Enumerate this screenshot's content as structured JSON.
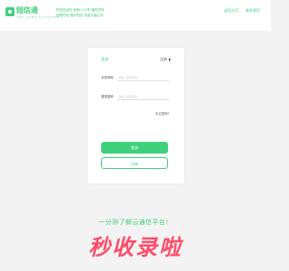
{
  "header": {
    "logo_text": "短信通",
    "logo_sub": "SMS TONG PLATFORM",
    "slogan_lines": [
      "短信验证码 营销 110条 通知短信",
      "视频短信 国际短信 流量充值业务"
    ],
    "links": [
      "返回主页",
      "联系我们"
    ]
  },
  "login": {
    "title": "登录",
    "register_link": "注册",
    "fields": [
      {
        "label": "手机号码",
        "placeholder": "请输入手机号码",
        "value": ""
      },
      {
        "label": "登录密码",
        "placeholder": "请输入登录密码",
        "value": ""
      }
    ],
    "forgot": "忘记密码？",
    "login_button": "登录",
    "register_button": "注册"
  },
  "promo": {
    "tagline": "一分钟了解云通信平台！",
    "headline": "秒收录啦"
  },
  "colors": {
    "accent": "#3fd07c",
    "headline": "#ff4d6a",
    "background": "#f3f3f3"
  },
  "icons": {
    "logo": "logo-icon",
    "register_arrow": "chevron-right-icon"
  }
}
